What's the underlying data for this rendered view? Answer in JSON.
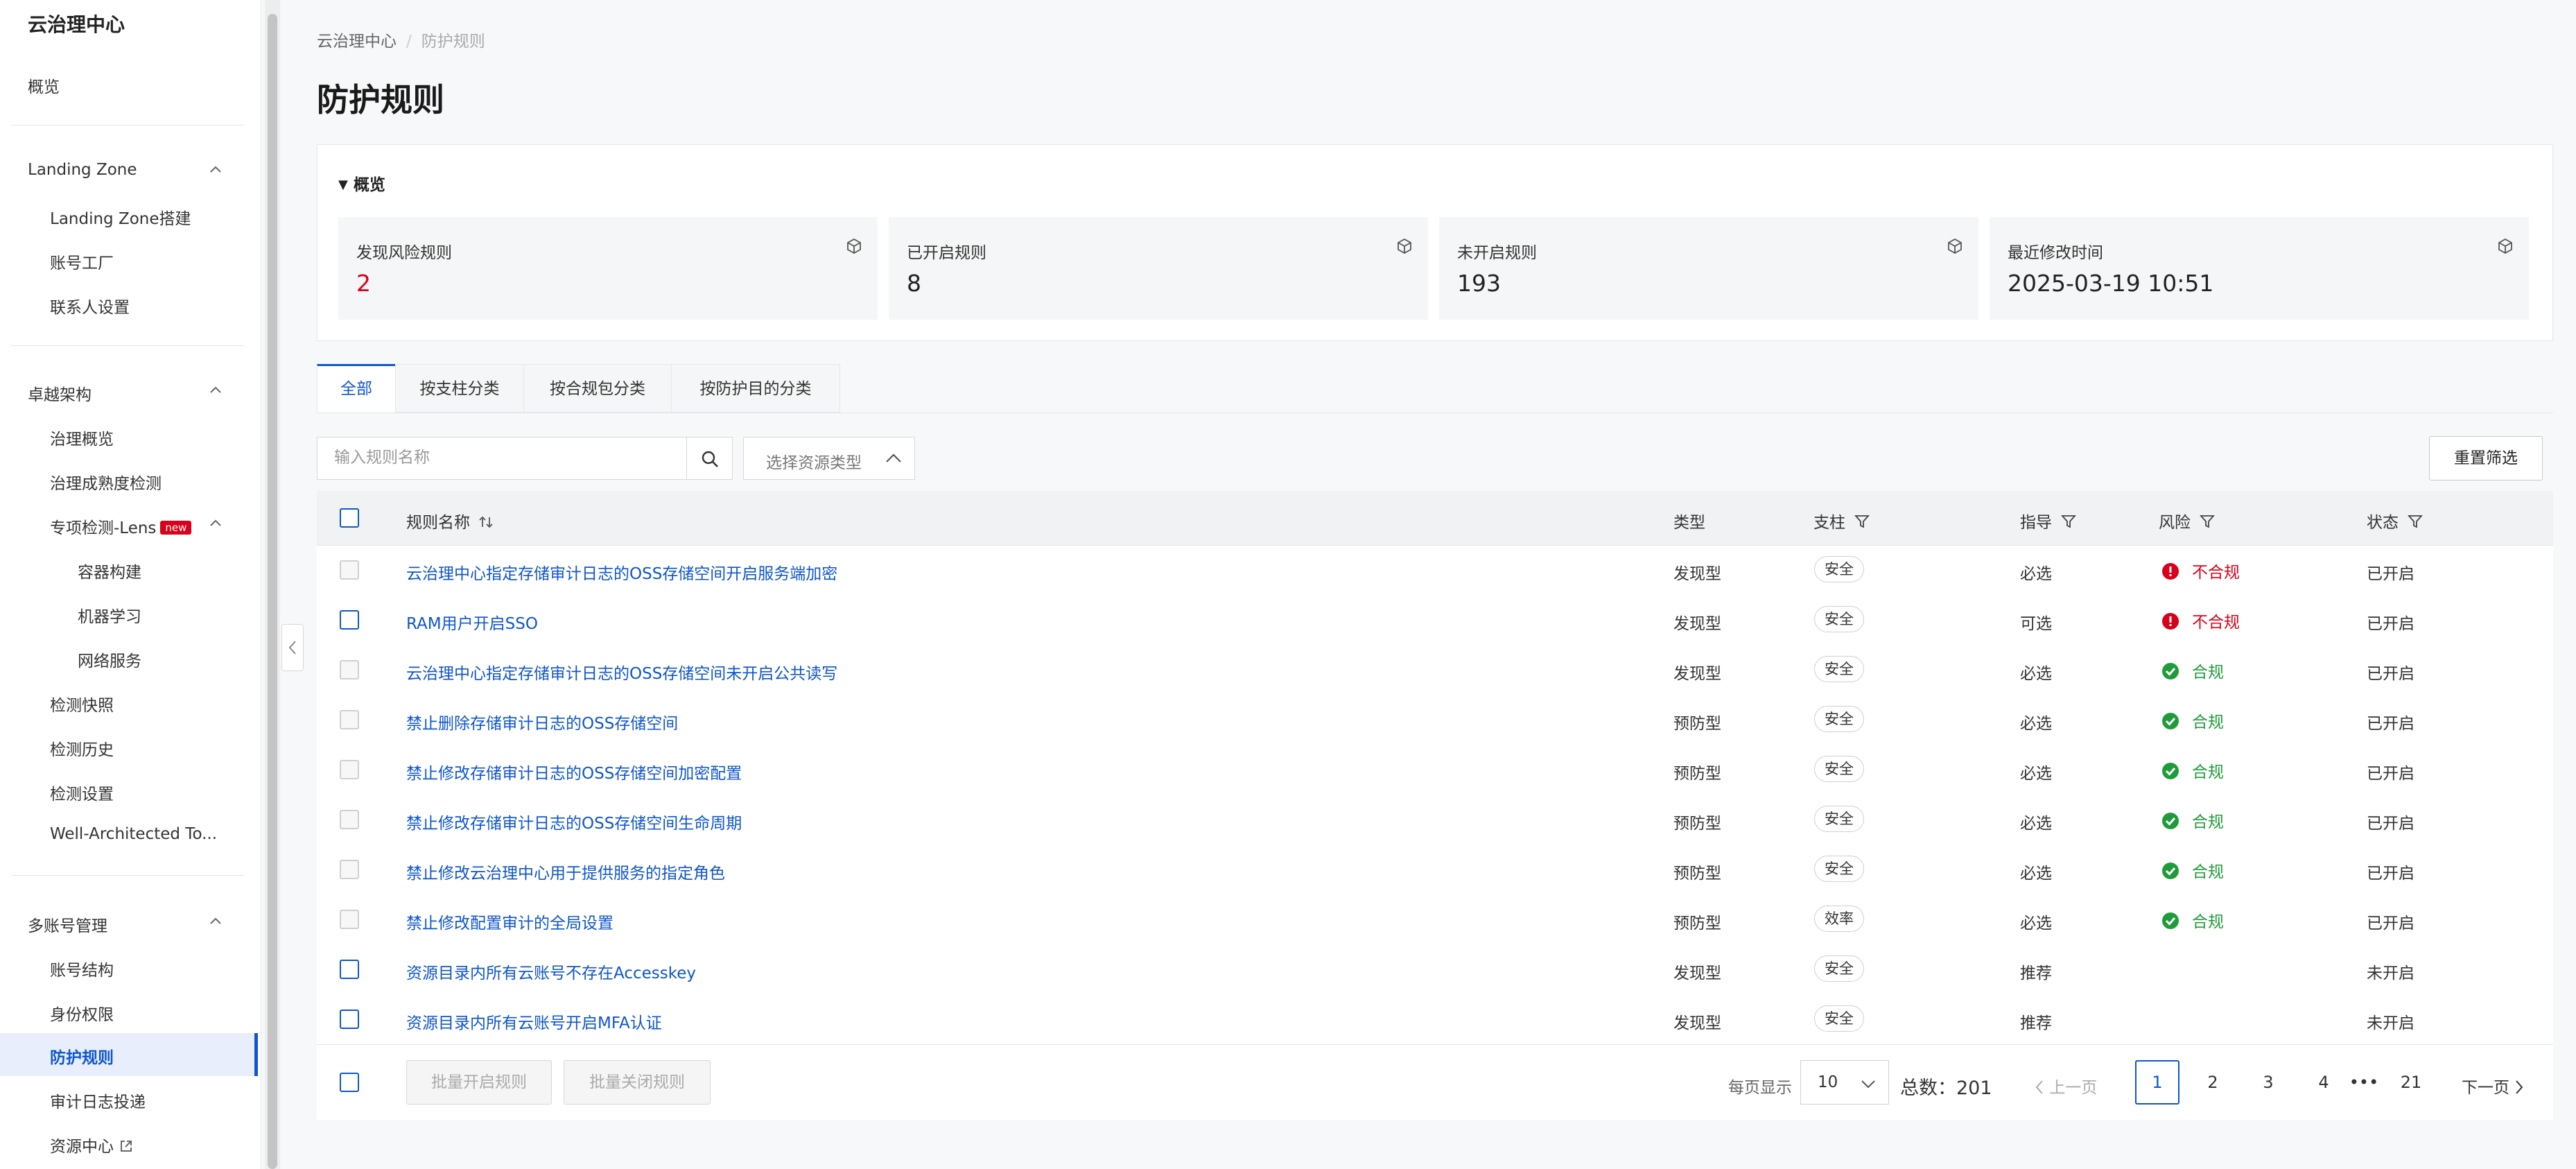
{
  "sidebar": {
    "title": "云治理中心",
    "overview": "概览",
    "landing_zone": {
      "header": "Landing Zone",
      "items": [
        "Landing Zone搭建",
        "账号工厂",
        "联系人设置"
      ]
    },
    "architecture": {
      "header": "卓越架构",
      "items": [
        "治理概览",
        "治理成熟度检测"
      ],
      "lens": {
        "label": "专项检测-Lens",
        "badge": "new",
        "items": [
          "容器构建",
          "机器学习",
          "网络服务"
        ]
      },
      "items2": [
        "检测快照",
        "检测历史",
        "检测设置",
        "Well-Architected To..."
      ]
    },
    "multi_account": {
      "header": "多账号管理",
      "items": [
        "账号结构",
        "身份权限",
        "防护规则",
        "审计日志投递",
        "资源中心"
      ],
      "active": "防护规则"
    }
  },
  "breadcrumb": {
    "root": "云治理中心",
    "separator": "/",
    "current": "防护规则"
  },
  "page_title": "防护规则",
  "overview_panel": {
    "title": "概览",
    "cards": [
      {
        "label": "发现风险规则",
        "value": "2",
        "icon": "cube-icon",
        "value_color": "#d9001b"
      },
      {
        "label": "已开启规则",
        "value": "8",
        "icon": "cube-icon"
      },
      {
        "label": "未开启规则",
        "value": "193",
        "icon": "cube-icon"
      },
      {
        "label": "最近修改时间",
        "value": "2025-03-19 10:51",
        "icon": "cube-icon"
      }
    ]
  },
  "tabs": [
    "全部",
    "按支柱分类",
    "按合规包分类",
    "按防护目的分类"
  ],
  "active_tab": "全部",
  "search": {
    "placeholder": "输入规则名称",
    "value": ""
  },
  "resource_type_select": {
    "placeholder": "选择资源类型"
  },
  "reset_button": "重置筛选",
  "table": {
    "columns": {
      "name": "规则名称",
      "type": "类型",
      "pillar": "支柱",
      "guidance": "指导",
      "risk": "风险",
      "status": "状态"
    },
    "rows": [
      {
        "name": "云治理中心指定存储审计日志的OSS存储空间开启服务端加密",
        "type": "发现型",
        "pillar": "安全",
        "guidance": "必选",
        "risk": "不合规",
        "risk_level": "bad",
        "status": "已开启",
        "selectable": false
      },
      {
        "name": "RAM用户开启SSO",
        "type": "发现型",
        "pillar": "安全",
        "guidance": "可选",
        "risk": "不合规",
        "risk_level": "bad",
        "status": "已开启",
        "selectable": true
      },
      {
        "name": "云治理中心指定存储审计日志的OSS存储空间未开启公共读写",
        "type": "发现型",
        "pillar": "安全",
        "guidance": "必选",
        "risk": "合规",
        "risk_level": "good",
        "status": "已开启",
        "selectable": false
      },
      {
        "name": "禁止删除存储审计日志的OSS存储空间",
        "type": "预防型",
        "pillar": "安全",
        "guidance": "必选",
        "risk": "合规",
        "risk_level": "good",
        "status": "已开启",
        "selectable": false
      },
      {
        "name": "禁止修改存储审计日志的OSS存储空间加密配置",
        "type": "预防型",
        "pillar": "安全",
        "guidance": "必选",
        "risk": "合规",
        "risk_level": "good",
        "status": "已开启",
        "selectable": false
      },
      {
        "name": "禁止修改存储审计日志的OSS存储空间生命周期",
        "type": "预防型",
        "pillar": "安全",
        "guidance": "必选",
        "risk": "合规",
        "risk_level": "good",
        "status": "已开启",
        "selectable": false
      },
      {
        "name": "禁止修改云治理中心用于提供服务的指定角色",
        "type": "预防型",
        "pillar": "安全",
        "guidance": "必选",
        "risk": "合规",
        "risk_level": "good",
        "status": "已开启",
        "selectable": false
      },
      {
        "name": "禁止修改配置审计的全局设置",
        "type": "预防型",
        "pillar": "效率",
        "guidance": "必选",
        "risk": "合规",
        "risk_level": "good",
        "status": "已开启",
        "selectable": false
      },
      {
        "name": "资源目录内所有云账号不存在Accesskey",
        "type": "发现型",
        "pillar": "安全",
        "guidance": "推荐",
        "risk": "",
        "risk_level": "none",
        "status": "未开启",
        "selectable": true
      },
      {
        "name": "资源目录内所有云账号开启MFA认证",
        "type": "发现型",
        "pillar": "安全",
        "guidance": "推荐",
        "risk": "",
        "risk_level": "none",
        "status": "未开启",
        "selectable": true
      }
    ]
  },
  "footer": {
    "batch_enable": "批量开启规则",
    "batch_disable": "批量关闭规则",
    "page_size_label": "每页显示",
    "page_size": "10",
    "total": "总数：201",
    "prev": "上一页",
    "next": "下一页",
    "pages": [
      "1",
      "2",
      "3",
      "4",
      "•••",
      "21"
    ],
    "current_page": "1"
  },
  "colors": {
    "accent": "#0f56cc",
    "danger": "#d9001b",
    "success": "#1f9c3a"
  }
}
